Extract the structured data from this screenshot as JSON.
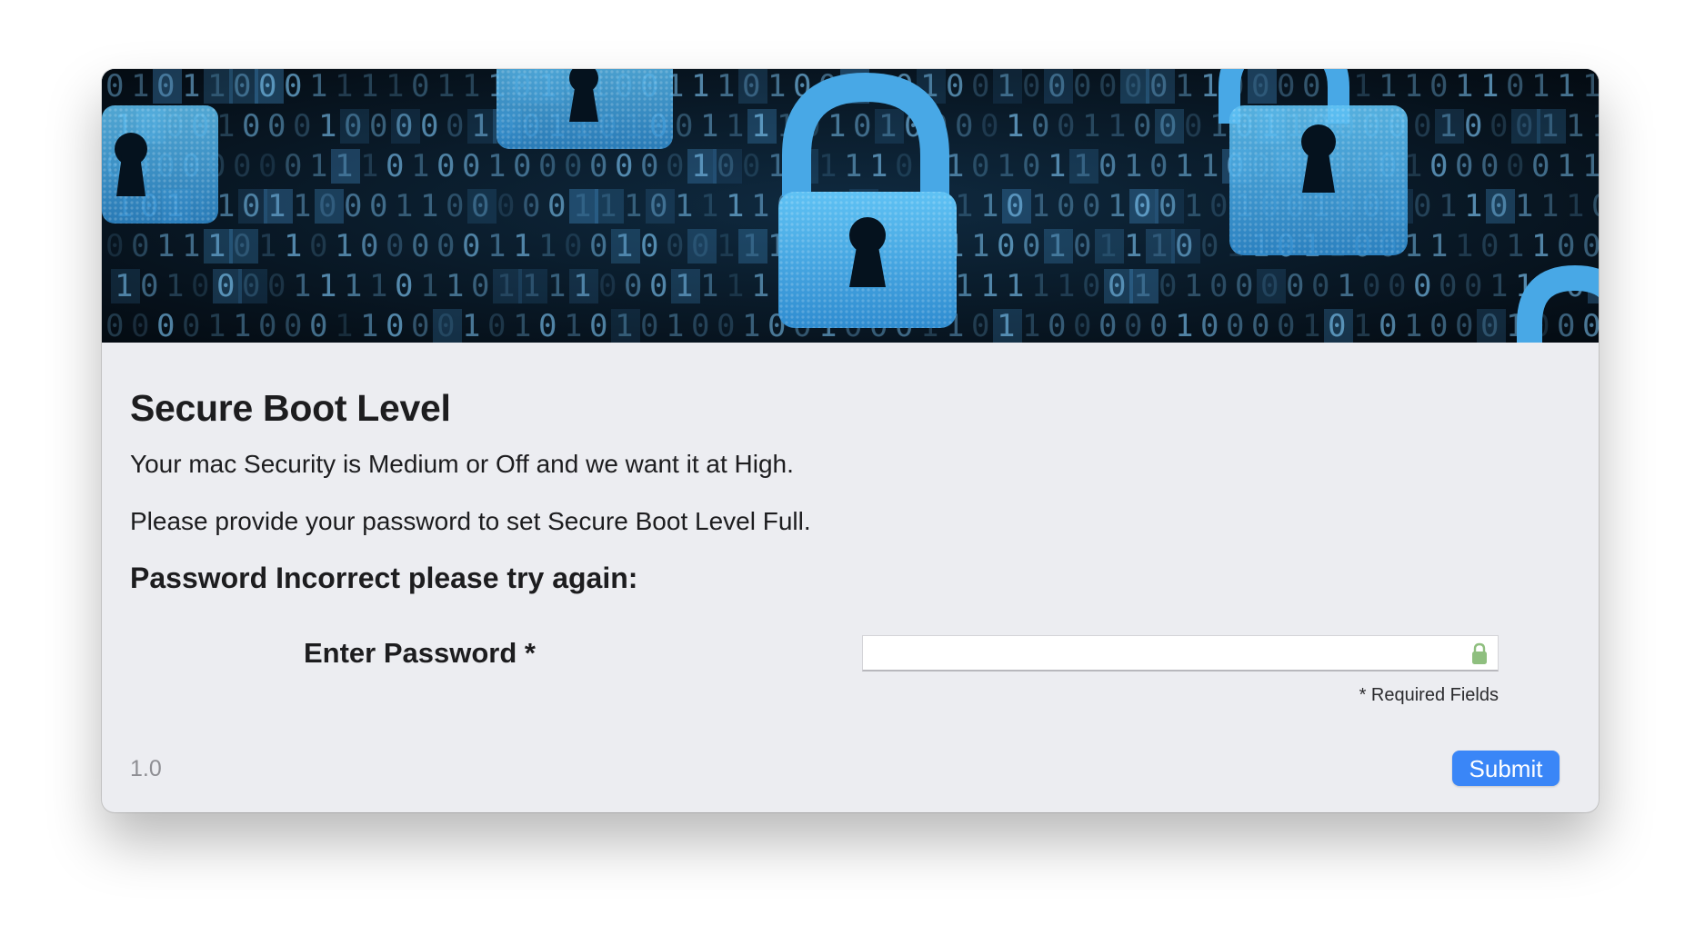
{
  "dialog": {
    "title": "Secure Boot Level",
    "message_line_1": "Your mac Security is Medium or Off and we want it at High.",
    "message_line_2": "Please provide your password to set Secure Boot Level Full.",
    "error_message": "Password Incorrect please try again:",
    "password_field": {
      "label": "Enter Password *",
      "value": "",
      "placeholder": "",
      "icon": "lock-icon"
    },
    "required_note": "* Required Fields",
    "version": "1.0",
    "submit_label": "Submit"
  },
  "banner": {
    "description_icon": "padlock-binary-banner",
    "binary_digits": [
      "0",
      "1"
    ]
  },
  "colors": {
    "window_background": "#ecedf1",
    "banner_background": "#06121c",
    "banner_accent": "#46a6e6",
    "submit_button": "#3a86f7",
    "lock_icon": "#8fbf7f",
    "version_text": "#8e8e93"
  }
}
